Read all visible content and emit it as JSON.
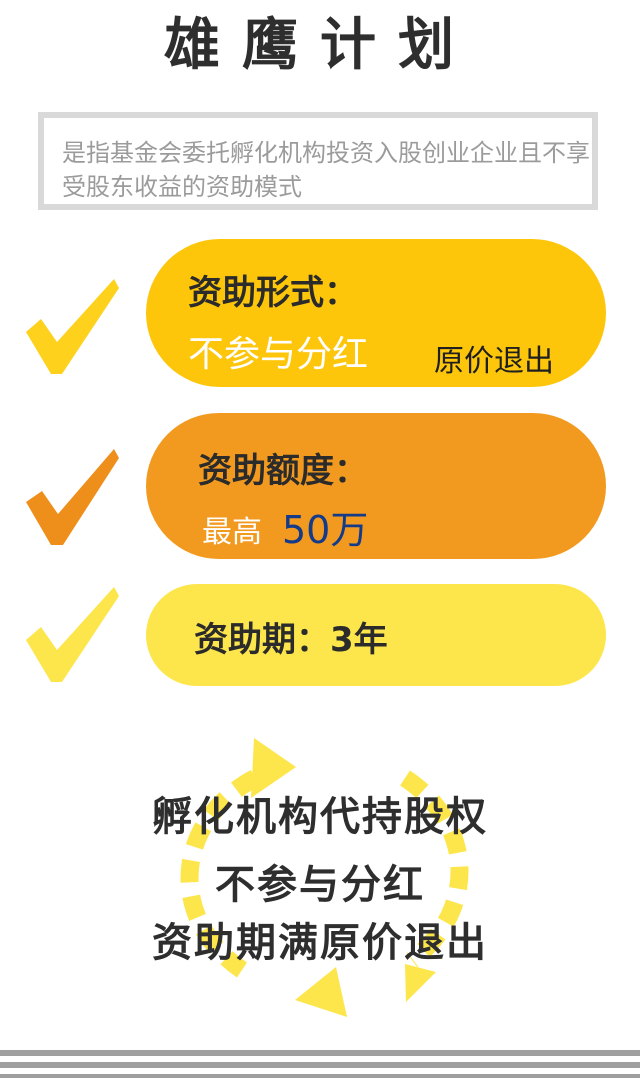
{
  "title": "雄鹰计划",
  "intro": {
    "text": "是指基金会委托孵化机构投资入股创业企业且不享受股东收益的资助模式"
  },
  "items": [
    {
      "label": "资助形式：",
      "main_value": "不参与分红",
      "sub_value": "原价退出",
      "color": "#fdc60b",
      "check_color": "#fdd11c"
    },
    {
      "label": "资助额度：",
      "pre_value": "最高",
      "amount": "50万",
      "color": "#f29a1f",
      "check_color": "#ef8f1b"
    },
    {
      "label": "资助期：3年",
      "color": "#fde64b",
      "check_color": "#fde64b"
    }
  ],
  "summary": {
    "line_1": "孵化机构代持股权",
    "line_2": "不参与分红",
    "line_3": "资助期满原价退出"
  }
}
